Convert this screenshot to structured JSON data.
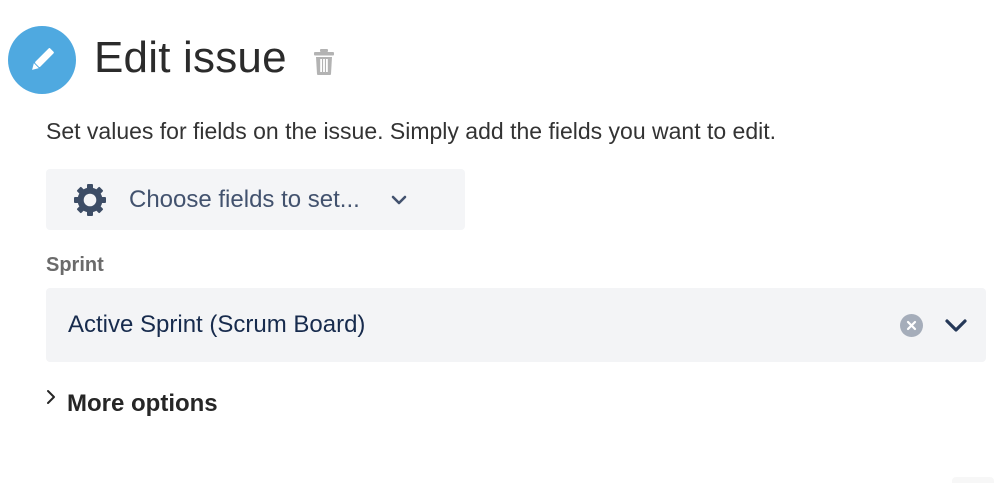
{
  "header": {
    "title": "Edit issue",
    "icon": "pencil-icon",
    "icon_bg_color": "#4fa9e0",
    "delete_icon": "trash-icon"
  },
  "description": "Set values for fields on the issue. Simply add the fields you want to edit.",
  "choose_fields": {
    "label": "Choose fields to set...",
    "icon": "gear-icon",
    "chevron_icon": "chevron-down-icon"
  },
  "sprint_field": {
    "label": "Sprint",
    "value": "Active Sprint (Scrum Board)",
    "clear_icon": "clear-icon",
    "dropdown_icon": "chevron-down-icon"
  },
  "more_options": {
    "label": "More options",
    "icon": "chevron-right-icon"
  },
  "colors": {
    "text_primary": "#172b4d",
    "select_bg": "#f4f5f7",
    "accent_blue": "#4fa9e0"
  }
}
